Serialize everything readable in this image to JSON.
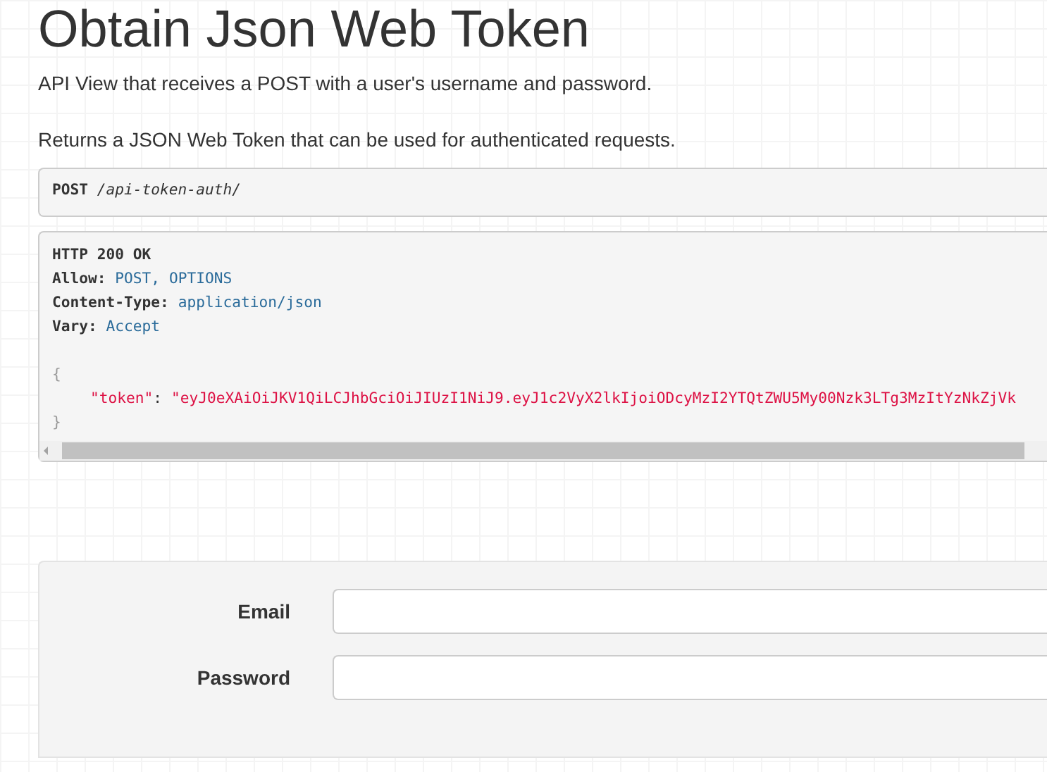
{
  "title": "Obtain Json Web Token",
  "description": [
    "API View that receives a POST with a user's username and password.",
    "Returns a JSON Web Token that can be used for authenticated requests."
  ],
  "request": {
    "method": "POST",
    "path": "/api-token-auth/"
  },
  "response": {
    "status": "HTTP 200 OK",
    "headers": [
      {
        "name": "Allow:",
        "value": "POST, OPTIONS"
      },
      {
        "name": "Content-Type:",
        "value": "application/json"
      },
      {
        "name": "Vary:",
        "value": "Accept"
      }
    ],
    "open_brace": "{",
    "key": "\"token\"",
    "colon": ":",
    "token_value": "\"eyJ0eXAiOiJKV1QiLCJhbGciOiJIUzI1NiJ9.eyJ1c2VyX2lkIjoiODcyMzI2YTQtZWU5My00Nzk3LTg3MzItYzNkZjVk",
    "close_brace": "}"
  },
  "form": {
    "fields": [
      {
        "label": "Email"
      },
      {
        "label": "Password"
      }
    ]
  }
}
